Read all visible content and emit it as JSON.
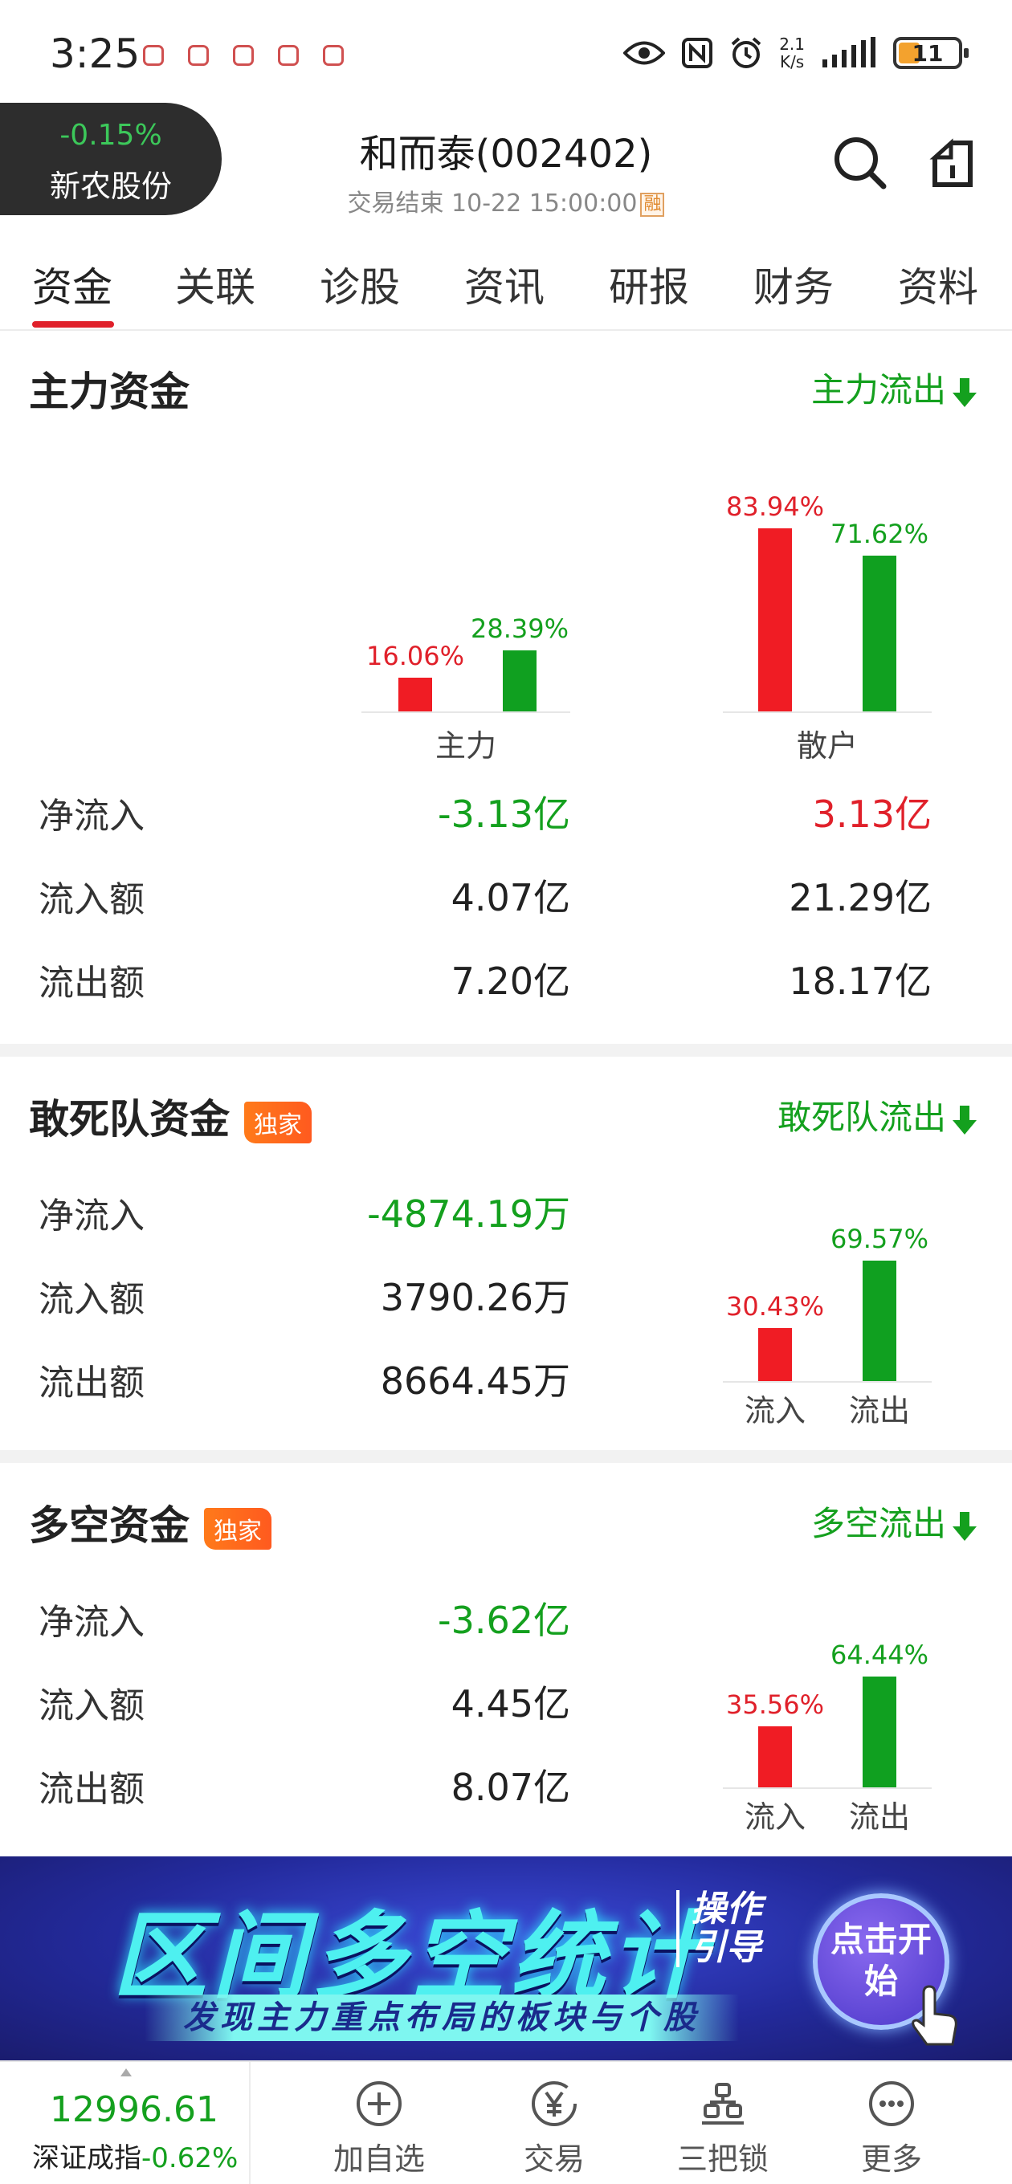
{
  "status": {
    "time": "3:25",
    "net_speed_value": "2.1",
    "net_speed_unit": "K/s",
    "battery": "11"
  },
  "header": {
    "linked_change": "-0.15%",
    "linked_name": "新农股份",
    "title": "和而泰(002402)",
    "subtitle": "交易结束 10-22 15:00:00",
    "badge": "融"
  },
  "tabs": [
    "资金",
    "关联",
    "诊股",
    "资讯",
    "研报",
    "财务",
    "资料"
  ],
  "main_funds": {
    "title": "主力资金",
    "flow_tag": "主力流出",
    "groups": [
      {
        "name": "主力",
        "in_pct": "16.06%",
        "out_pct": "28.39%"
      },
      {
        "name": "散户",
        "in_pct": "83.94%",
        "out_pct": "71.62%"
      }
    ],
    "rows": [
      {
        "label": "净流入",
        "main": "-3.13亿",
        "retail": "3.13亿"
      },
      {
        "label": "流入额",
        "main": "4.07亿",
        "retail": "21.29亿"
      },
      {
        "label": "流出额",
        "main": "7.20亿",
        "retail": "18.17亿"
      }
    ]
  },
  "dare_funds": {
    "title": "敢死队资金",
    "badge": "独家",
    "flow_tag": "敢死队流出",
    "rows": [
      {
        "label": "净流入",
        "value": "-4874.19万"
      },
      {
        "label": "流入额",
        "value": "3790.26万"
      },
      {
        "label": "流出额",
        "value": "8664.45万"
      }
    ],
    "in_pct": "30.43%",
    "out_pct": "69.57%",
    "in_label": "流入",
    "out_label": "流出"
  },
  "longshort_funds": {
    "title": "多空资金",
    "badge": "独家",
    "flow_tag": "多空流出",
    "rows": [
      {
        "label": "净流入",
        "value": "-3.62亿"
      },
      {
        "label": "流入额",
        "value": "4.45亿"
      },
      {
        "label": "流出额",
        "value": "8.07亿"
      }
    ],
    "in_pct": "35.56%",
    "out_pct": "64.44%",
    "in_label": "流入",
    "out_label": "流出"
  },
  "banner": {
    "title": "区间多空统计",
    "tag": "操作引导",
    "subtitle": "发现主力重点布局的板块与个股",
    "button": "点击开始"
  },
  "bottom": {
    "index_value": "12996.61",
    "index_name": "深证成指",
    "index_change": "-0.62%",
    "nav": [
      "加自选",
      "交易",
      "三把锁",
      "更多"
    ]
  },
  "colors": {
    "up_red": "#f01c24",
    "down_green": "#10a020",
    "accent": "#e0202a"
  }
}
